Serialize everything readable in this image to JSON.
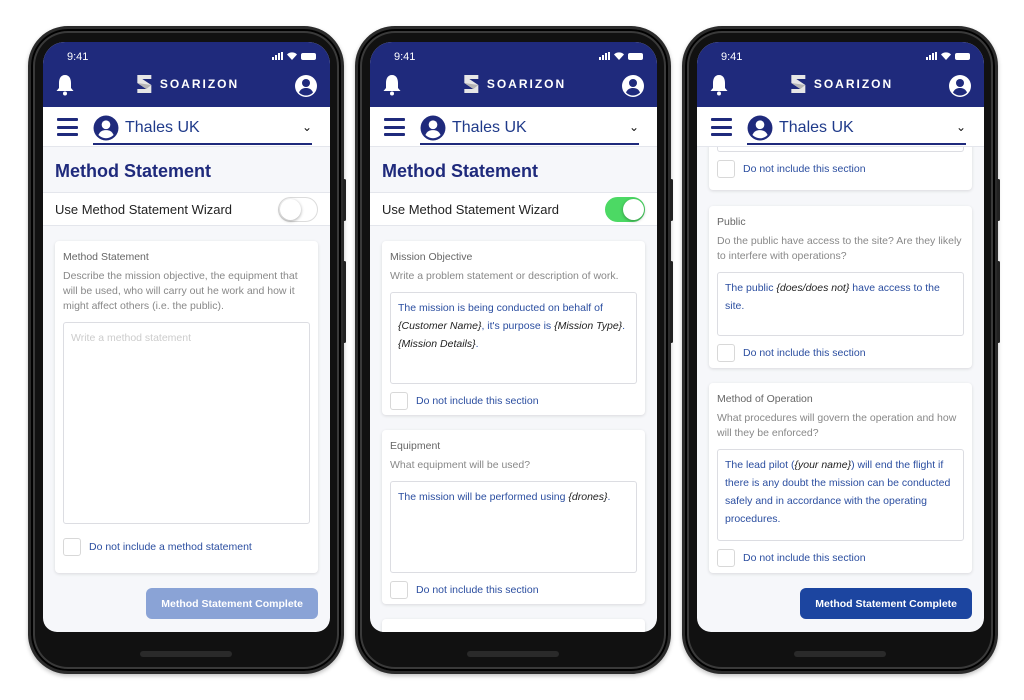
{
  "common": {
    "status_time": "9:41",
    "brand_name": "SOARIZON",
    "organization": "Thales UK",
    "page_title": "Method Statement",
    "wizard_label": "Use Method Statement Wizard",
    "complete_button": "Method Statement Complete",
    "section_exclude_label": "Do not include this section",
    "colors": {
      "header_bg": "#1f2a7c",
      "accent_text": "#2b4ea0",
      "toggle_on": "#4cd964",
      "button_enabled": "#1c45a0",
      "button_disabled": "#8aa3d6"
    }
  },
  "screens": [
    {
      "wizard_enabled": false,
      "button_state": "disabled",
      "card": {
        "title": "Method Statement",
        "description": "Describe the mission objective, the equipment that will be used, who will carry out he work and how it might affect others (i.e. the public).",
        "placeholder": "Write a method statement",
        "exclude_label": "Do not include a method statement"
      }
    },
    {
      "wizard_enabled": true,
      "sections": [
        {
          "title": "Mission Objective",
          "description": "Write a problem statement or description of work.",
          "text_parts": [
            {
              "t": "The mission is being conducted on behalf of ",
              "v": false
            },
            {
              "t": "{Customer Name}",
              "v": true
            },
            {
              "t": ", it's purpose is ",
              "v": false
            },
            {
              "t": "{Mission Type}",
              "v": true
            },
            {
              "t": ". ",
              "v": false
            },
            {
              "t": "{Mission Details}",
              "v": true
            },
            {
              "t": ".",
              "v": false
            }
          ]
        },
        {
          "title": "Equipment",
          "description": "What equipment will be used?",
          "text_parts": [
            {
              "t": "The mission will be performed using ",
              "v": false
            },
            {
              "t": "{drones}",
              "v": true
            },
            {
              "t": ".",
              "v": false
            }
          ]
        }
      ]
    },
    {
      "wizard_enabled": true,
      "button_state": "enabled",
      "sections": [
        {
          "title": "Public",
          "description": "Do the public have access to the site? Are they likely to interfere with operations?",
          "text_parts": [
            {
              "t": "The public ",
              "v": false
            },
            {
              "t": "{does/does not}",
              "v": true
            },
            {
              "t": " have access to the site.",
              "v": false
            }
          ]
        },
        {
          "title": "Method of Operation",
          "description": "What procedures will govern the operation and how will they be enforced?",
          "text_parts": [
            {
              "t": "The lead pilot (",
              "v": false
            },
            {
              "t": "{your name}",
              "v": true
            },
            {
              "t": ") will end the flight if there is any doubt the mission can be conducted safely and in accordance with the operating procedures.",
              "v": false
            }
          ]
        }
      ]
    }
  ]
}
